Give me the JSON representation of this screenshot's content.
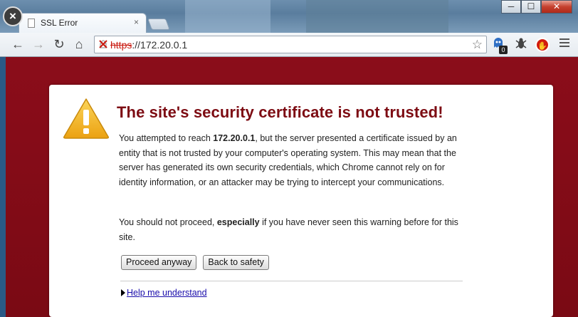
{
  "window": {
    "tab_title": "SSL Error",
    "tab_close": "×",
    "close_overlay": "×",
    "controls": {
      "minimize": "─",
      "maximize": "☐",
      "close": "✕"
    }
  },
  "toolbar": {
    "back": "←",
    "forward": "→",
    "reload": "↻",
    "home": "⌂",
    "url_scheme": "https",
    "url_rest": "://172.20.0.1",
    "star": "☆",
    "extension_badge": "0",
    "stop_label": "✋"
  },
  "page": {
    "heading": "The site's security certificate is not trusted!",
    "p1_before": "You attempted to reach ",
    "p1_host": "172.20.0.1",
    "p1_after": ", but the server presented a certificate issued by an entity that is not trusted by your computer's operating system. This may mean that the server has generated its own security credentials, which Chrome cannot rely on for identity information, or an attacker may be trying to intercept your communications.",
    "p2_before": "You should not proceed, ",
    "p2_bold": "especially",
    "p2_after": " if you have never seen this warning before for this site.",
    "proceed_label": "Proceed anyway",
    "back_label": "Back to safety",
    "help_label": "Help me understand"
  },
  "colors": {
    "page_background": "#8b0d1a",
    "heading": "#7d0c13",
    "link": "#1a0dab",
    "warning_icon": "#f2b01e"
  }
}
